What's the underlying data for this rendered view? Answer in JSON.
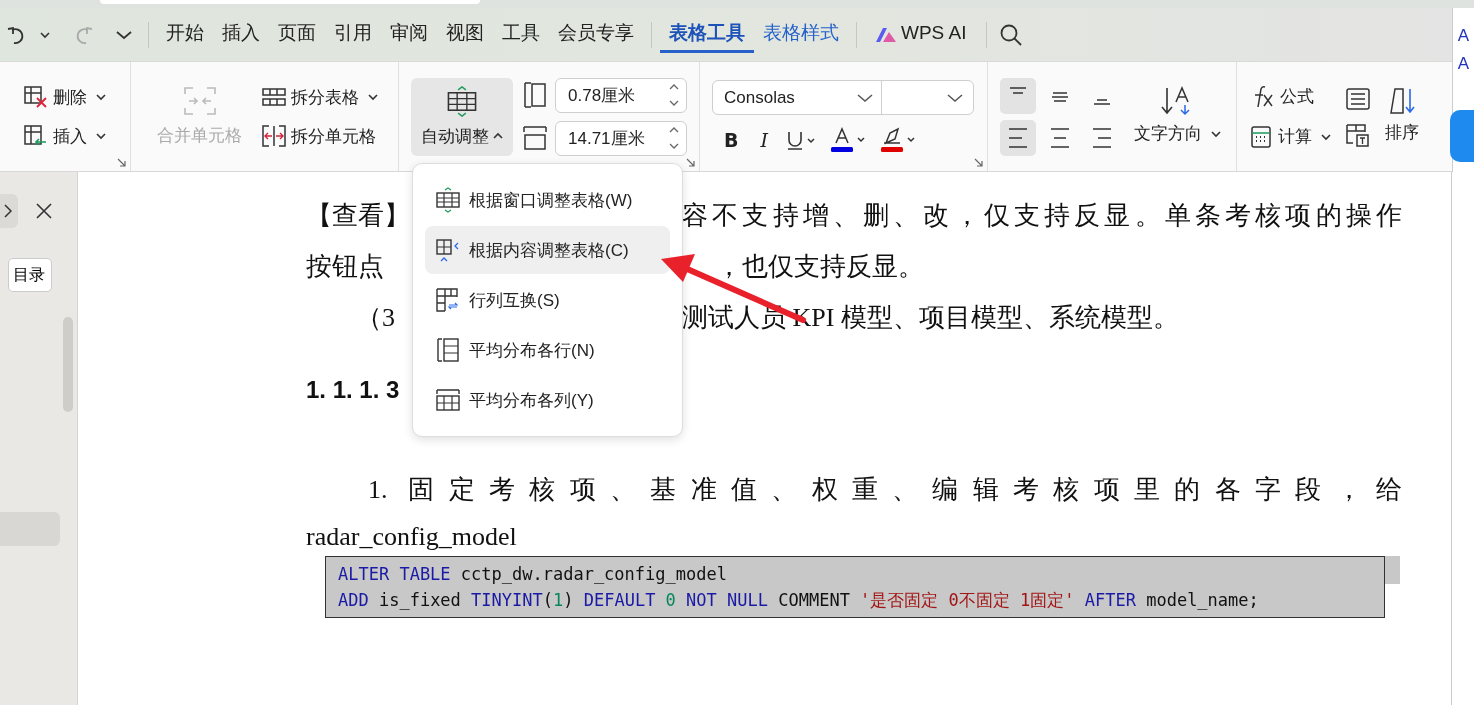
{
  "menubar": {
    "tabs": [
      {
        "label": "开始",
        "selected": false
      },
      {
        "label": "插入",
        "selected": false
      },
      {
        "label": "页面",
        "selected": false
      },
      {
        "label": "引用",
        "selected": false
      },
      {
        "label": "审阅",
        "selected": false
      },
      {
        "label": "视图",
        "selected": false
      },
      {
        "label": "工具",
        "selected": false
      },
      {
        "label": "会员专享",
        "selected": false
      },
      {
        "label": "表格工具",
        "selected": true
      },
      {
        "label": "表格样式",
        "selected": false
      }
    ],
    "ai_label": "WPS AI"
  },
  "ribbon": {
    "delete": "删除",
    "insert": "插入",
    "merge_cells": "合并单元格",
    "split_table": "拆分表格",
    "split_cells": "拆分单元格",
    "autofit": "自动调整",
    "row_height": "0.78厘米",
    "col_width": "14.71厘米",
    "font": "Consolas",
    "bold": "B",
    "italic": "I",
    "text_direction": "文字方向",
    "formula": "公式",
    "calc": "计算",
    "sort": "排序"
  },
  "menu": {
    "items": [
      {
        "label": "根据窗口调整表格(W)",
        "selected": false
      },
      {
        "label": "根据内容调整表格(C)",
        "selected": true
      },
      {
        "label": "行列互换(S)",
        "selected": false
      },
      {
        "label": "平均分布各行(N)",
        "selected": false
      },
      {
        "label": "平均分布各列(Y)",
        "selected": false
      }
    ]
  },
  "sidebar": {
    "refresh": "目录"
  },
  "right_panel": [
    "A",
    "A"
  ],
  "document": {
    "line_1_left": "【查看】",
    "line_1_right": "容不支持增、删、改，仅支持反显。单条考核项的操作",
    "line_2_left": "按钮点",
    "line_2_right": "，也仅支持反显。",
    "line_3_left": "（3",
    "line_3_right": "测试人员 KPI 模型、项目模型、系统模型。",
    "heading": "1. 1. 1. 3",
    "paragraph": "1. 固定考核项、基准值、权重、编辑考核项里的各字段，给",
    "paragraph_end": "radar_config_model",
    "code": [
      [
        {
          "text": "ALTER TABLE ",
          "kind": "keyword"
        },
        {
          "text": "cctp_dw.radar_config_model",
          "kind": "plain"
        }
      ],
      [
        {
          "text": "ADD ",
          "kind": "keyword"
        },
        {
          "text": "is_fixed ",
          "kind": "plain"
        },
        {
          "text": "TINYINT",
          "kind": "keyword"
        },
        {
          "text": "(",
          "kind": "plain"
        },
        {
          "text": "1",
          "kind": "number"
        },
        {
          "text": ") ",
          "kind": "plain"
        },
        {
          "text": "DEFAULT ",
          "kind": "keyword"
        },
        {
          "text": "0 ",
          "kind": "number"
        },
        {
          "text": "NOT NULL ",
          "kind": "keyword"
        },
        {
          "text": "COMMENT ",
          "kind": "plain"
        },
        {
          "text": "'是否固定 0不固定 1固定' ",
          "kind": "string"
        },
        {
          "text": "AFTER ",
          "kind": "keyword"
        },
        {
          "text": "model_name;",
          "kind": "plain"
        }
      ]
    ]
  }
}
